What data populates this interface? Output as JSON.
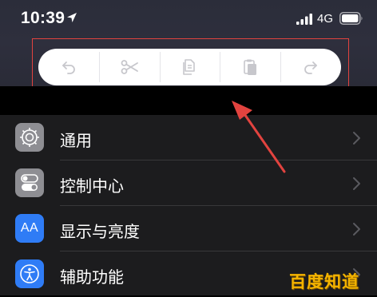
{
  "status_bar": {
    "time": "10:39",
    "network": "4G",
    "icons": [
      "location-arrow-icon",
      "cellular-signal-icon",
      "battery-icon"
    ]
  },
  "edit_toolbar": {
    "buttons": [
      {
        "icon": "undo-icon"
      },
      {
        "icon": "cut-icon"
      },
      {
        "icon": "copy-icon"
      },
      {
        "icon": "paste-icon"
      },
      {
        "icon": "redo-icon"
      }
    ]
  },
  "settings": {
    "items": [
      {
        "label": "通用",
        "icon": "gear-icon",
        "icon_bg": "#8e8e93"
      },
      {
        "label": "控制中心",
        "icon": "toggles-icon",
        "icon_bg": "#8e8e93"
      },
      {
        "label": "显示与亮度",
        "icon": "text-size-icon",
        "icon_bg": "#2f7cf6",
        "icon_text": "AA"
      },
      {
        "label": "辅助功能",
        "icon": "accessibility-icon",
        "icon_bg": "#2f7cf6"
      }
    ]
  },
  "watermark": {
    "text": "百度知道"
  },
  "colors": {
    "annotation": "#e2433f",
    "group_bg": "#1c1c1e",
    "blue": "#2f7cf6",
    "gray": "#8e8e93"
  }
}
